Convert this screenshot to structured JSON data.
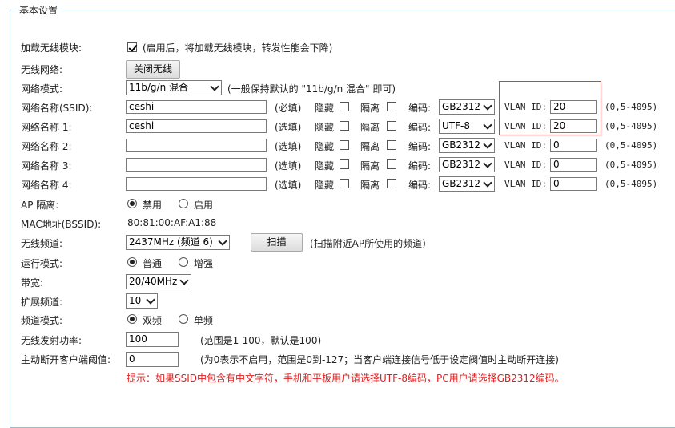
{
  "section_title": "基本设置",
  "load_module": {
    "label": "加载无线模块:",
    "checked": true,
    "note": "(启用后，将加载无线模块，转发性能会下降)"
  },
  "wireless_net": {
    "label": "无线网络:",
    "button": "关闭无线"
  },
  "net_mode": {
    "label": "网络模式:",
    "value": "11b/g/n 混合",
    "note": "(一般保持默认的 \"11b/g/n 混合\" 即可)"
  },
  "ssids": [
    {
      "label": "网络名称(SSID):",
      "value": "ceshi",
      "req": "(必填)",
      "hide": "隐藏",
      "isolate": "隔离",
      "enc_label": "编码:",
      "enc": "GB2312",
      "vlan_label": "VLAN ID:",
      "vlan": "20",
      "range": "(0,5-4095)"
    },
    {
      "label": "网络名称 1:",
      "value": "ceshi",
      "req": "(选填)",
      "hide": "隐藏",
      "isolate": "隔离",
      "enc_label": "编码:",
      "enc": "UTF-8",
      "vlan_label": "VLAN ID:",
      "vlan": "20",
      "range": "(0,5-4095)"
    },
    {
      "label": "网络名称 2:",
      "value": "",
      "req": "(选填)",
      "hide": "隐藏",
      "isolate": "隔离",
      "enc_label": "编码:",
      "enc": "GB2312",
      "vlan_label": "VLAN ID:",
      "vlan": "0",
      "range": "(0,5-4095)"
    },
    {
      "label": "网络名称 3:",
      "value": "",
      "req": "(选填)",
      "hide": "隐藏",
      "isolate": "隔离",
      "enc_label": "编码:",
      "enc": "GB2312",
      "vlan_label": "VLAN ID:",
      "vlan": "0",
      "range": "(0,5-4095)"
    },
    {
      "label": "网络名称 4:",
      "value": "",
      "req": "(选填)",
      "hide": "隐藏",
      "isolate": "隔离",
      "enc_label": "编码:",
      "enc": "GB2312",
      "vlan_label": "VLAN ID:",
      "vlan": "0",
      "range": "(0,5-4095)"
    }
  ],
  "ap_isolation": {
    "label": "AP 隔离:",
    "opt1": "禁用",
    "opt2": "启用",
    "selected": "禁用"
  },
  "mac": {
    "label": "MAC地址(BSSID):",
    "value": "80:81:00:AF:A1:88"
  },
  "channel": {
    "label": "无线频道:",
    "value": "2437MHz (频道 6)",
    "scan_button": "扫描",
    "note": "(扫描附近AP所使用的频道)"
  },
  "run_mode": {
    "label": "运行模式:",
    "opt1": "普通",
    "opt2": "增强",
    "selected": "普通"
  },
  "bandwidth": {
    "label": "带宽:",
    "value": "20/40MHz"
  },
  "ext_channel": {
    "label": "扩展频道:",
    "value": "10"
  },
  "channel_mode": {
    "label": "频道模式:",
    "opt1": "双频",
    "opt2": "单频",
    "selected": "双频"
  },
  "tx_power": {
    "label": "无线发射功率:",
    "value": "100",
    "note": "(范围是1-100，默认是100)"
  },
  "kick_threshold": {
    "label": "主动断开客户端阈值:",
    "value": "0",
    "note": "(为0表示不启用，范围是0到-127；当客户端连接信号低于设定阀值时主动断开连接)"
  },
  "hint": "提示：如果SSID中包含有中文字符，手机和平板用户请选择UTF-8编码，PC用户请选择GB2312编码。"
}
